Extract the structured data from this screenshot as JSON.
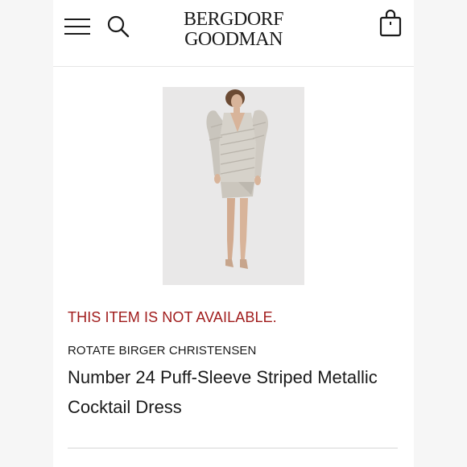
{
  "header": {
    "logo_line1": "BERGDORF",
    "logo_line2": "GOODMAN",
    "menu_icon": "hamburger-menu-icon",
    "search_icon": "search-icon",
    "bag_icon": "shopping-bag-icon"
  },
  "product": {
    "status": "THIS ITEM IS NOT AVAILABLE.",
    "designer": "ROTATE BIRGER CHRISTENSEN",
    "name": "Number 24 Puff-Sleeve Striped Metallic Cocktail Dress"
  },
  "colors": {
    "status": "#a01c1c",
    "text": "#1a1a1a",
    "image_bg": "#e9e8e8"
  }
}
